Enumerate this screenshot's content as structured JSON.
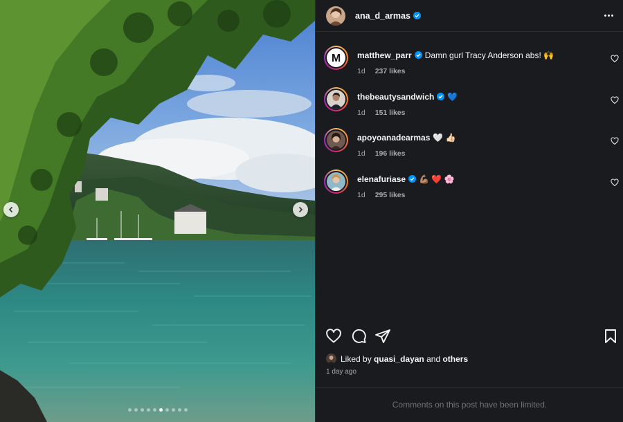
{
  "post": {
    "author": "ana_d_armas",
    "author_verified": true,
    "more_icon": "more-horizontal-icon"
  },
  "photo": {
    "description_icons": [
      "chevron-left-icon",
      "chevron-right-icon"
    ],
    "carousel_count": 10,
    "carousel_active_index": 5
  },
  "comments": [
    {
      "username": "matthew_parr",
      "verified": true,
      "text": "Damn gurl Tracy Anderson abs! 🙌",
      "age": "1d",
      "likes": "237 likes"
    },
    {
      "username": "thebeautysandwich",
      "verified": true,
      "text": "💙",
      "age": "1d",
      "likes": "151 likes"
    },
    {
      "username": "apoyoanadearmas",
      "verified": false,
      "text": "🤍 👍🏻",
      "age": "1d",
      "likes": "196 likes"
    },
    {
      "username": "elenafuriase",
      "verified": true,
      "text": "💪🏽 ❤️ 🌸",
      "age": "1d",
      "likes": "295 likes"
    }
  ],
  "liked_by": {
    "prefix": "Liked by",
    "user": "quasi_dayan",
    "conjunction": "and",
    "others": "others"
  },
  "time_ago": "1 day ago",
  "comments_notice": "Comments on this post have been limited.",
  "colors": {
    "panel_bg": "#1a1b1f",
    "verified_blue": "#0095f6",
    "muted_text": "#a8a8a8"
  }
}
